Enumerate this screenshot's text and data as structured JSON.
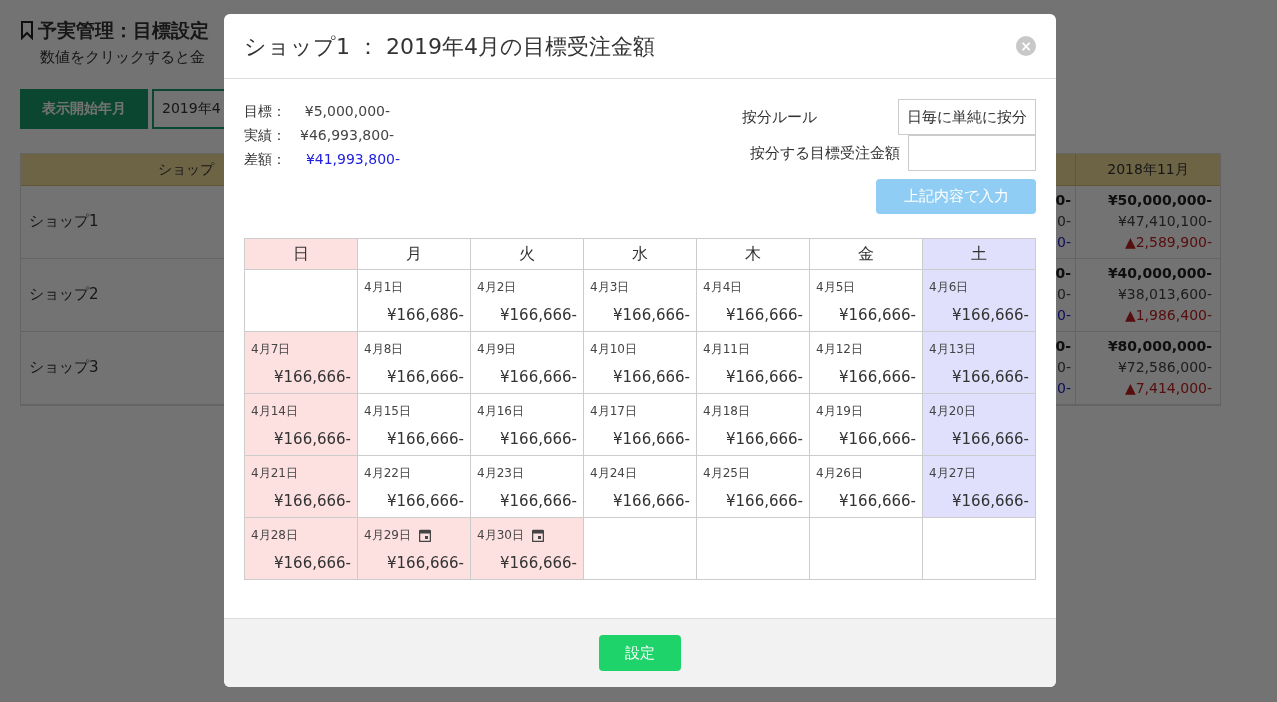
{
  "page": {
    "title": "予実管理：目標設定",
    "subtitle": "数値をクリックすると金",
    "start_button": "表示開始年月",
    "start_field": "2019年4"
  },
  "table": {
    "columns": [
      {
        "label": "ショップ"
      },
      {},
      {
        "label": "2018年11月"
      }
    ],
    "rows": [
      {
        "shop": "ショップ1",
        "column_2": [
          {
            "kind": "target",
            "text": "0-"
          },
          {
            "kind": "actual",
            "text": "0-"
          },
          {
            "kind": "diff",
            "text": "0-"
          }
        ],
        "nov": [
          {
            "kind": "target",
            "text": "¥50,000,000-"
          },
          {
            "kind": "actual",
            "text": "¥47,410,100-"
          },
          {
            "kind": "deficit",
            "text": "▲2,589,900-"
          }
        ]
      },
      {
        "shop": "ショップ2",
        "column_2": [
          {
            "kind": "target",
            "text": "0-"
          },
          {
            "kind": "actual",
            "text": "0-"
          },
          {
            "kind": "diff",
            "text": "0-"
          }
        ],
        "nov": [
          {
            "kind": "target",
            "text": "¥40,000,000-"
          },
          {
            "kind": "actual",
            "text": "¥38,013,600-"
          },
          {
            "kind": "deficit",
            "text": "▲1,986,400-"
          }
        ]
      },
      {
        "shop": "ショップ3",
        "column_2": [
          {
            "kind": "target",
            "text": "0-"
          },
          {
            "kind": "actual",
            "text": "0-"
          },
          {
            "kind": "diff",
            "text": "0-"
          }
        ],
        "nov": [
          {
            "kind": "target",
            "text": "¥80,000,000-"
          },
          {
            "kind": "actual",
            "text": "¥72,586,000-"
          },
          {
            "kind": "deficit",
            "text": "▲7,414,000-"
          }
        ]
      }
    ]
  },
  "modal": {
    "title": "ショップ1 ： 2019年4月の目標受注金額",
    "close": "×",
    "summary": [
      {
        "label": "目標：",
        "value": "¥5,000,000-",
        "kind": "plain"
      },
      {
        "label": "実績：",
        "value": "¥46,993,800-",
        "kind": "plain"
      },
      {
        "label": "差額：",
        "value": "¥41,993,800-",
        "kind": "surplus"
      }
    ],
    "rule_label": "按分ルール",
    "rule_value": "日毎に単純に按分",
    "amount_label": "按分する目標受注金額",
    "apply_button": "上記内容で入力",
    "weekdays": [
      {
        "label": "日",
        "kind": "sun"
      },
      {
        "label": "月",
        "kind": "weekday"
      },
      {
        "label": "火",
        "kind": "weekday"
      },
      {
        "label": "水",
        "kind": "weekday"
      },
      {
        "label": "木",
        "kind": "weekday"
      },
      {
        "label": "金",
        "kind": "weekday"
      },
      {
        "label": "土",
        "kind": "sat"
      }
    ],
    "weeks": [
      [
        {
          "kind": "blank"
        },
        {
          "date": "4月1日",
          "amount": "¥166,686-",
          "kind": "weekday",
          "holiday": false
        },
        {
          "date": "4月2日",
          "amount": "¥166,666-",
          "kind": "weekday",
          "holiday": false
        },
        {
          "date": "4月3日",
          "amount": "¥166,666-",
          "kind": "weekday",
          "holiday": false
        },
        {
          "date": "4月4日",
          "amount": "¥166,666-",
          "kind": "weekday",
          "holiday": false
        },
        {
          "date": "4月5日",
          "amount": "¥166,666-",
          "kind": "weekday",
          "holiday": false
        },
        {
          "date": "4月6日",
          "amount": "¥166,666-",
          "kind": "sat",
          "holiday": false
        }
      ],
      [
        {
          "date": "4月7日",
          "amount": "¥166,666-",
          "kind": "sun",
          "holiday": false
        },
        {
          "date": "4月8日",
          "amount": "¥166,666-",
          "kind": "weekday",
          "holiday": false
        },
        {
          "date": "4月9日",
          "amount": "¥166,666-",
          "kind": "weekday",
          "holiday": false
        },
        {
          "date": "4月10日",
          "amount": "¥166,666-",
          "kind": "weekday",
          "holiday": false
        },
        {
          "date": "4月11日",
          "amount": "¥166,666-",
          "kind": "weekday",
          "holiday": false
        },
        {
          "date": "4月12日",
          "amount": "¥166,666-",
          "kind": "weekday",
          "holiday": false
        },
        {
          "date": "4月13日",
          "amount": "¥166,666-",
          "kind": "sat",
          "holiday": false
        }
      ],
      [
        {
          "date": "4月14日",
          "amount": "¥166,666-",
          "kind": "sun",
          "holiday": false
        },
        {
          "date": "4月15日",
          "amount": "¥166,666-",
          "kind": "weekday",
          "holiday": false
        },
        {
          "date": "4月16日",
          "amount": "¥166,666-",
          "kind": "weekday",
          "holiday": false
        },
        {
          "date": "4月17日",
          "amount": "¥166,666-",
          "kind": "weekday",
          "holiday": false
        },
        {
          "date": "4月18日",
          "amount": "¥166,666-",
          "kind": "weekday",
          "holiday": false
        },
        {
          "date": "4月19日",
          "amount": "¥166,666-",
          "kind": "weekday",
          "holiday": false
        },
        {
          "date": "4月20日",
          "amount": "¥166,666-",
          "kind": "sat",
          "holiday": false
        }
      ],
      [
        {
          "date": "4月21日",
          "amount": "¥166,666-",
          "kind": "sun",
          "holiday": false
        },
        {
          "date": "4月22日",
          "amount": "¥166,666-",
          "kind": "weekday",
          "holiday": false
        },
        {
          "date": "4月23日",
          "amount": "¥166,666-",
          "kind": "weekday",
          "holiday": false
        },
        {
          "date": "4月24日",
          "amount": "¥166,666-",
          "kind": "weekday",
          "holiday": false
        },
        {
          "date": "4月25日",
          "amount": "¥166,666-",
          "kind": "weekday",
          "holiday": false
        },
        {
          "date": "4月26日",
          "amount": "¥166,666-",
          "kind": "weekday",
          "holiday": false
        },
        {
          "date": "4月27日",
          "amount": "¥166,666-",
          "kind": "sat",
          "holiday": false
        }
      ],
      [
        {
          "date": "4月28日",
          "amount": "¥166,666-",
          "kind": "sun",
          "holiday": false
        },
        {
          "date": "4月29日",
          "amount": "¥166,666-",
          "kind": "weekday",
          "holiday": true
        },
        {
          "date": "4月30日",
          "amount": "¥166,666-",
          "kind": "weekday",
          "holiday": true
        },
        {
          "kind": "blank"
        },
        {
          "kind": "blank"
        },
        {
          "kind": "blank"
        },
        {
          "kind": "blank"
        }
      ]
    ],
    "submit_button": "設定"
  }
}
